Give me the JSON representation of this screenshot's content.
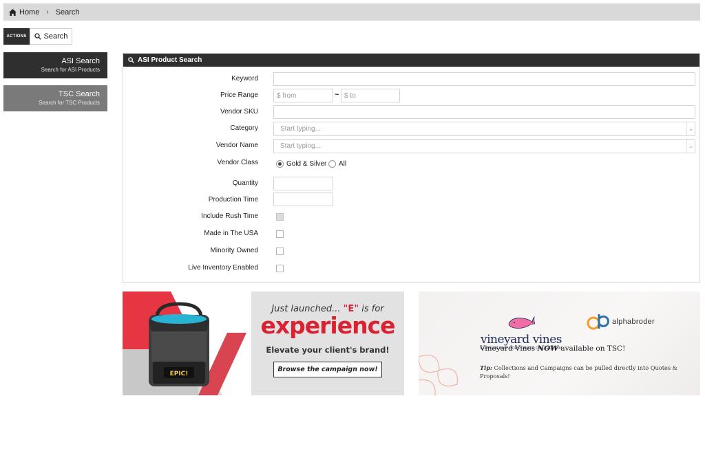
{
  "breadcrumb": {
    "home": "Home",
    "separator": "›",
    "current": "Search"
  },
  "actions": {
    "tag": "ACTIONS",
    "search_label": "Search"
  },
  "sidebar": {
    "items": [
      {
        "title": "ASI Search",
        "subtitle": "Search for ASI Products"
      },
      {
        "title": "TSC Search",
        "subtitle": "Search for TSC Products"
      }
    ]
  },
  "form": {
    "title": "ASI Product Search",
    "keyword": {
      "label": "Keyword",
      "value": ""
    },
    "price": {
      "label": "Price Range",
      "from_placeholder": "$ from",
      "separator": "~",
      "to_placeholder": "$ to"
    },
    "sku": {
      "label": "Vendor SKU",
      "value": ""
    },
    "category": {
      "label": "Category",
      "placeholder": "Start typing..."
    },
    "vendor_name": {
      "label": "Vendor Name",
      "placeholder": "Start typing..."
    },
    "vendor_class": {
      "label": "Vendor Class",
      "options": [
        "Gold & Silver",
        "All"
      ],
      "selected": "Gold & Silver"
    },
    "quantity": {
      "label": "Quantity",
      "value": ""
    },
    "production_time": {
      "label": "Production Time",
      "value": ""
    },
    "rush": {
      "label": "Include Rush Time"
    },
    "usa": {
      "label": "Made in The USA"
    },
    "minority": {
      "label": "Minority Owned"
    },
    "inventory": {
      "label": "Live Inventory Enabled"
    }
  },
  "banner_left": {
    "just_launched": "Just launched...",
    "e_quote": "\"E\"",
    "is_for": "is for",
    "headline": "experience",
    "tagline": "Elevate your client's brand!",
    "cta": "Browse the campaign now!",
    "bag_text": "EPIC!"
  },
  "banner_right": {
    "vv_name": "vineyard vines",
    "vv_sub": "CUSTOM AND CORPORATE COLLECTION",
    "ab_name": "alphabroder",
    "now_prefix": "Vineyard Vines ",
    "now_em": "NOW",
    "now_suffix": " available on TSC!",
    "tip_label": "Tip:",
    "tip_text": " Collections and Campaigns can be pulled directly into Quotes & Proposals!"
  },
  "colors": {
    "dark": "#2f2f2f",
    "sidebar_alt": "#7a7a7a",
    "accent_red": "#d92332",
    "vv_navy": "#1e2a55"
  }
}
